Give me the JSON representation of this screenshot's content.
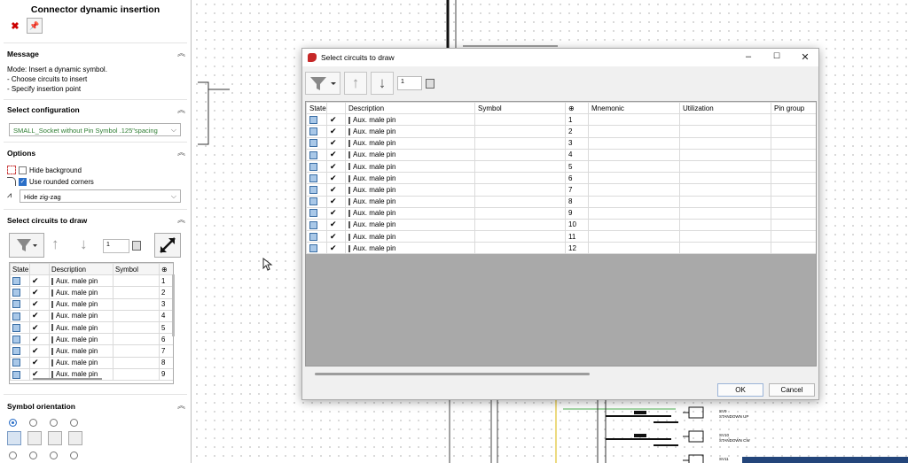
{
  "panel": {
    "title": "Connector dynamic insertion",
    "message": {
      "header": "Message",
      "lines": [
        "Mode: Insert a dynamic symbol.",
        "- Choose circuits to insert",
        "- Specify insertion point"
      ]
    },
    "configuration": {
      "header": "Select configuration",
      "value": "SMALL_Socket without Pin Symbol .125\"spacing"
    },
    "options": {
      "header": "Options",
      "hide_background": "Hide background",
      "use_rounded_corners": "Use rounded corners",
      "zigzag_value": "Hide zig-zag"
    },
    "circuits": {
      "header": "Select circuits to draw",
      "spin_value": "1",
      "columns": [
        "State",
        "",
        "Description",
        "Symbol",
        "⊕"
      ],
      "rows": [
        {
          "desc": "Aux. male pin",
          "num": "1"
        },
        {
          "desc": "Aux. male pin",
          "num": "2"
        },
        {
          "desc": "Aux. male pin",
          "num": "3"
        },
        {
          "desc": "Aux. male pin",
          "num": "4"
        },
        {
          "desc": "Aux. male pin",
          "num": "5"
        },
        {
          "desc": "Aux. male pin",
          "num": "6"
        },
        {
          "desc": "Aux. male pin",
          "num": "7"
        },
        {
          "desc": "Aux. male pin",
          "num": "8"
        },
        {
          "desc": "Aux. male pin",
          "num": "9"
        }
      ]
    },
    "orientation": {
      "header": "Symbol orientation"
    }
  },
  "canvas": {
    "labels": [
      "SV9",
      "STANDOWN UP",
      "SV10",
      "STANDOWN CW",
      "SV11"
    ]
  },
  "dialog": {
    "title": "Select circuits to draw",
    "spin_value": "1",
    "columns": [
      "State",
      "",
      "Description",
      "Symbol",
      "⊕",
      "Mnemonic",
      "Utilization",
      "Pin group"
    ],
    "rows": [
      {
        "desc": "Aux. male pin",
        "num": "1"
      },
      {
        "desc": "Aux. male pin",
        "num": "2"
      },
      {
        "desc": "Aux. male pin",
        "num": "3"
      },
      {
        "desc": "Aux. male pin",
        "num": "4"
      },
      {
        "desc": "Aux. male pin",
        "num": "5"
      },
      {
        "desc": "Aux. male pin",
        "num": "6"
      },
      {
        "desc": "Aux. male pin",
        "num": "7"
      },
      {
        "desc": "Aux. male pin",
        "num": "8"
      },
      {
        "desc": "Aux. male pin",
        "num": "9"
      },
      {
        "desc": "Aux. male pin",
        "num": "10"
      },
      {
        "desc": "Aux. male pin",
        "num": "11"
      },
      {
        "desc": "Aux. male pin",
        "num": "12"
      }
    ],
    "ok_label": "OK",
    "cancel_label": "Cancel"
  },
  "colors": {
    "accent": "#2b6fc8",
    "close_red": "#cc0000",
    "grid_gray": "#a9a9a9"
  }
}
